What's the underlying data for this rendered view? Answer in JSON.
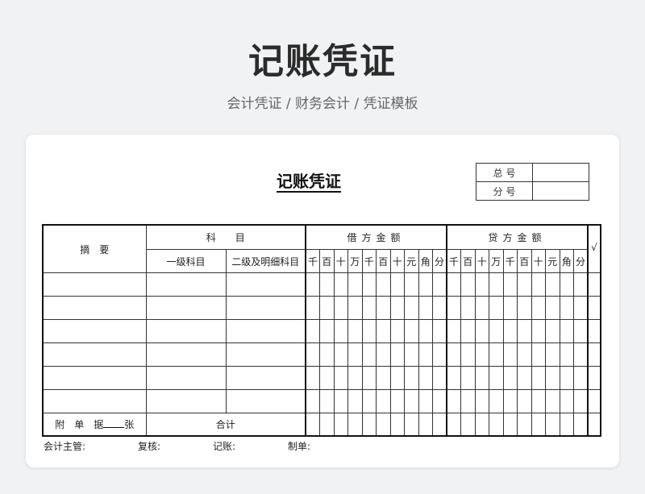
{
  "page": {
    "title": "记账凭证",
    "subtitle": "会计凭证 / 财务会计 / 凭证模板"
  },
  "voucher": {
    "title": "记账凭证",
    "total_no_label": "总 号",
    "sub_no_label": "分 号",
    "headers": {
      "summary": "摘　要",
      "account": "科　　目",
      "level1": "一级科目",
      "level2": "二级及明细科目",
      "debit": "借方金额",
      "credit": "贷方金额",
      "check": "√"
    },
    "units": [
      "千",
      "百",
      "十",
      "万",
      "千",
      "百",
      "十",
      "元",
      "角",
      "分"
    ],
    "footer": {
      "attach_prefix": "附　单　据",
      "attach_suffix": "张",
      "total": "合计"
    },
    "signatures": {
      "supervisor": "会计主管:",
      "reviewer": "复核:",
      "bookkeeper": "记账:",
      "maker": "制单:"
    }
  }
}
